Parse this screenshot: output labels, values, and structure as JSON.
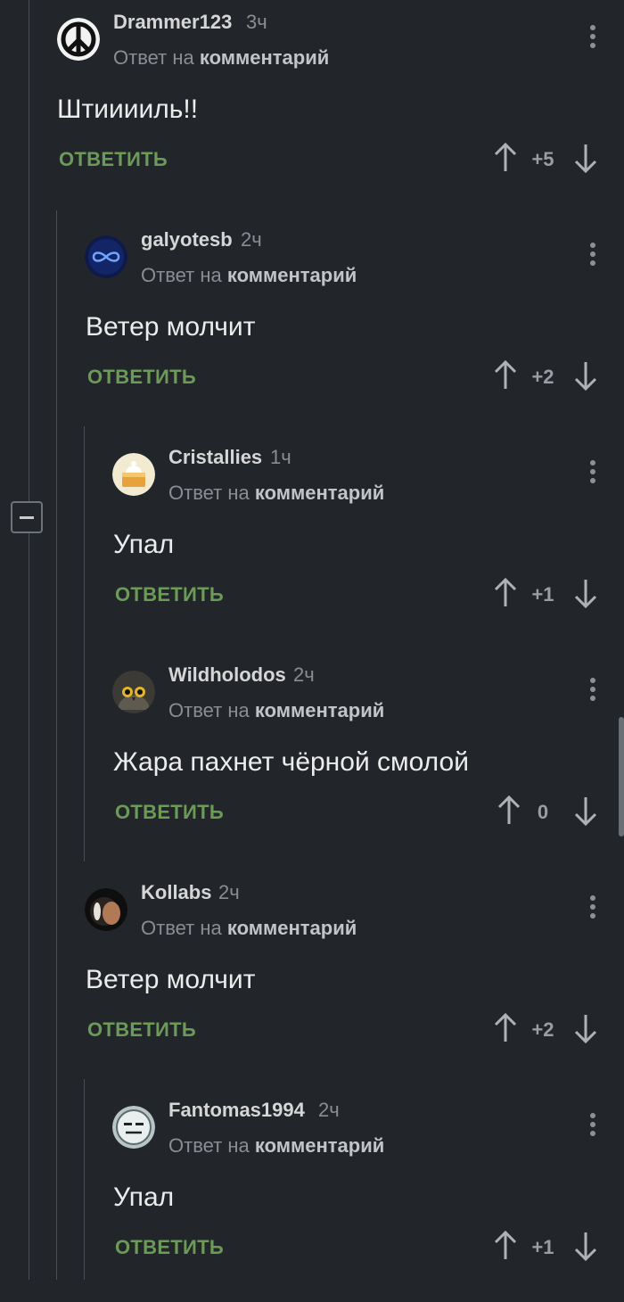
{
  "ui": {
    "reply_prefix": "Ответ на",
    "reply_target": "комментарий",
    "reply_button": "ОТВЕТИТЬ"
  },
  "comments": [
    {
      "author": "Drammer123",
      "time": "3ч",
      "text": "Штииииль!!",
      "score": "+5",
      "avatar": "peace-sign-icon"
    },
    {
      "author": "galyotesb",
      "time": "2ч",
      "text": "Ветер молчит",
      "score": "+2",
      "avatar": "infinity-icon"
    },
    {
      "author": "Cristallies",
      "time": "1ч",
      "text": "Упал",
      "score": "+1",
      "avatar": "cake-icon"
    },
    {
      "author": "Wildholodos",
      "time": "2ч",
      "text": "Жара пахнет чёрной смолой",
      "score": "0",
      "avatar": "owl-icon"
    },
    {
      "author": "Kollabs",
      "time": "2ч",
      "text": "Ветер молчит",
      "score": "+2",
      "avatar": "sphere-icon"
    },
    {
      "author": "Fantomas1994",
      "time": "2ч",
      "text": "Упал",
      "score": "+1",
      "avatar": "face-icon"
    }
  ],
  "colors": {
    "background": "#22262b",
    "reply_button": "#6c9a57",
    "thread_line": "#4a4f55"
  }
}
